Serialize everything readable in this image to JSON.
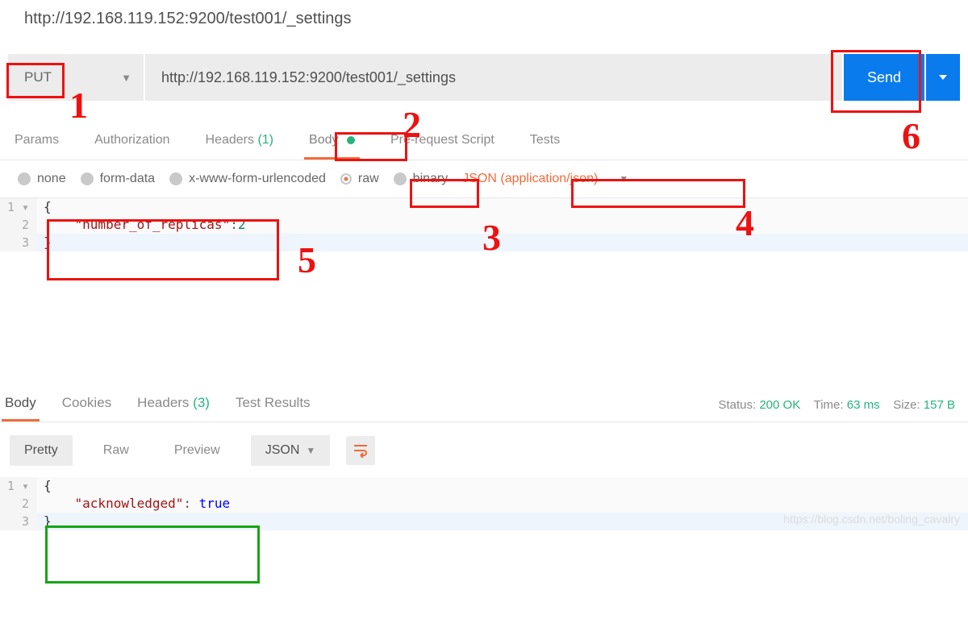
{
  "header_url": "http://192.168.119.152:9200/test001/_settings",
  "request": {
    "method": "PUT",
    "url": "http://192.168.119.152:9200/test001/_settings",
    "send_label": "Send"
  },
  "tabs": {
    "params": "Params",
    "authorization": "Authorization",
    "headers": "Headers",
    "headers_count": "(1)",
    "body": "Body",
    "prerequest": "Pre-request Script",
    "tests": "Tests"
  },
  "body_types": {
    "none": "none",
    "form_data": "form-data",
    "x_www": "x-www-form-urlencoded",
    "raw": "raw",
    "binary": "binary",
    "content_type": "JSON (application/json)"
  },
  "request_body_lines": {
    "l1": "{",
    "l2_key": "\"number_of_replicas\"",
    "l2_sep": ":",
    "l2_val": "2",
    "l3": "}"
  },
  "response_tabs": {
    "body": "Body",
    "cookies": "Cookies",
    "headers": "Headers",
    "headers_count": "(3)",
    "test_results": "Test Results"
  },
  "response_meta": {
    "status_label": "Status:",
    "status_value": "200 OK",
    "time_label": "Time:",
    "time_value": "63 ms",
    "size_label": "Size:",
    "size_value": "157 B"
  },
  "response_view": {
    "pretty": "Pretty",
    "raw": "Raw",
    "preview": "Preview",
    "format": "JSON"
  },
  "response_body_lines": {
    "l1": "{",
    "l2_key": "\"acknowledged\"",
    "l2_sep": ": ",
    "l2_val": "true",
    "l3": "}"
  },
  "watermark": "https://blog.csdn.net/boling_cavalry",
  "annotations": {
    "n1": "1",
    "n2": "2",
    "n3": "3",
    "n4": "4",
    "n5": "5",
    "n6": "6"
  }
}
